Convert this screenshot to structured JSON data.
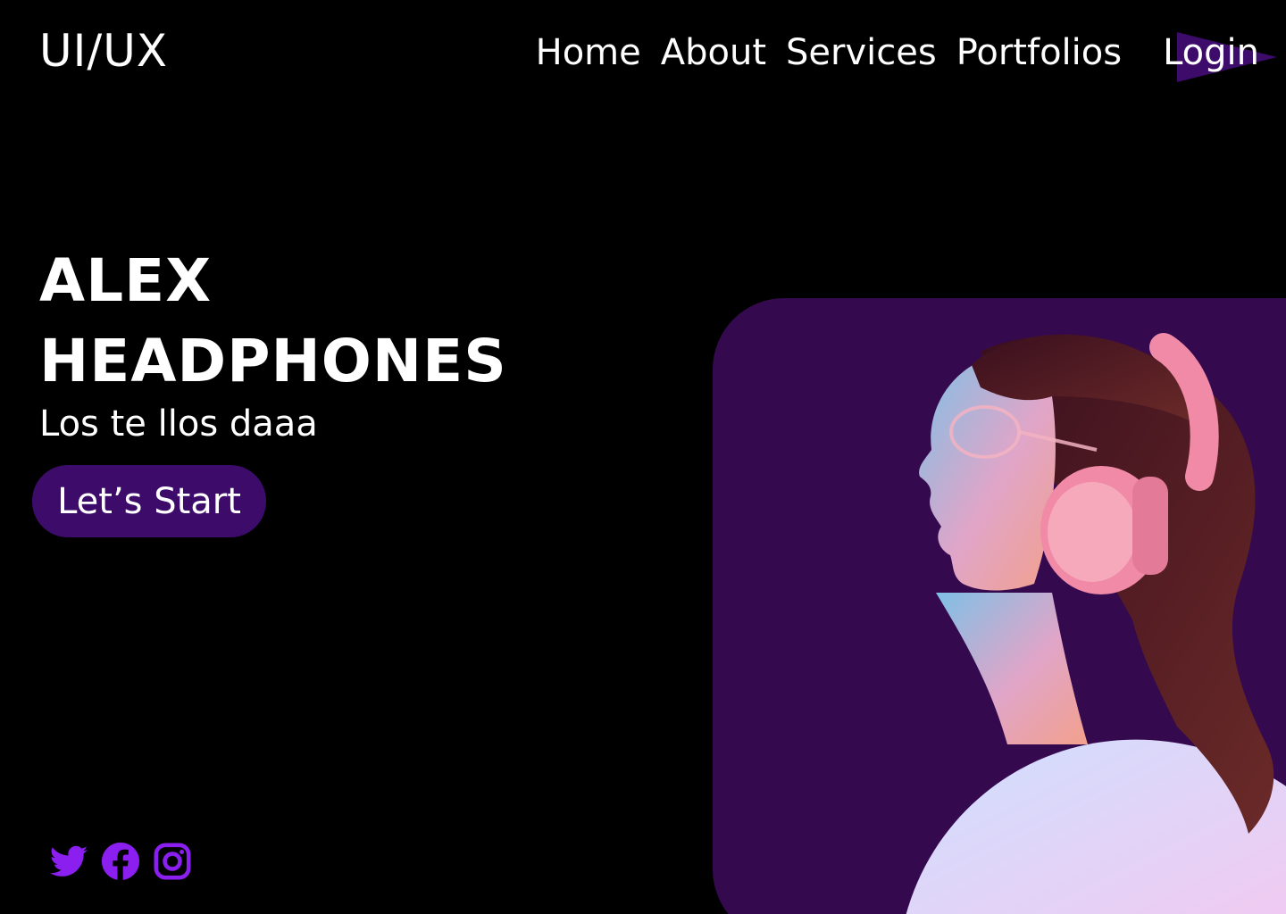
{
  "header": {
    "logo": "UI/UX",
    "nav": [
      {
        "label": "Home"
      },
      {
        "label": "About"
      },
      {
        "label": "Services"
      },
      {
        "label": "Portfolios"
      }
    ],
    "login_label": "Login"
  },
  "hero": {
    "title_line1": "ALEX",
    "title_line2": "HEADPHONES",
    "tagline": "Los te llos daaa",
    "cta_label": "Let’s Start"
  },
  "socials": [
    {
      "icon": "twitter-icon"
    },
    {
      "icon": "facebook-icon"
    },
    {
      "icon": "instagram-icon"
    }
  ],
  "colors": {
    "background": "#000000",
    "accent_purple": "#3d0c6b",
    "panel_purple": "#34094e",
    "social_purple": "#8a1ff0",
    "headphone_pink": "#f08aa6",
    "text": "#ffffff"
  }
}
